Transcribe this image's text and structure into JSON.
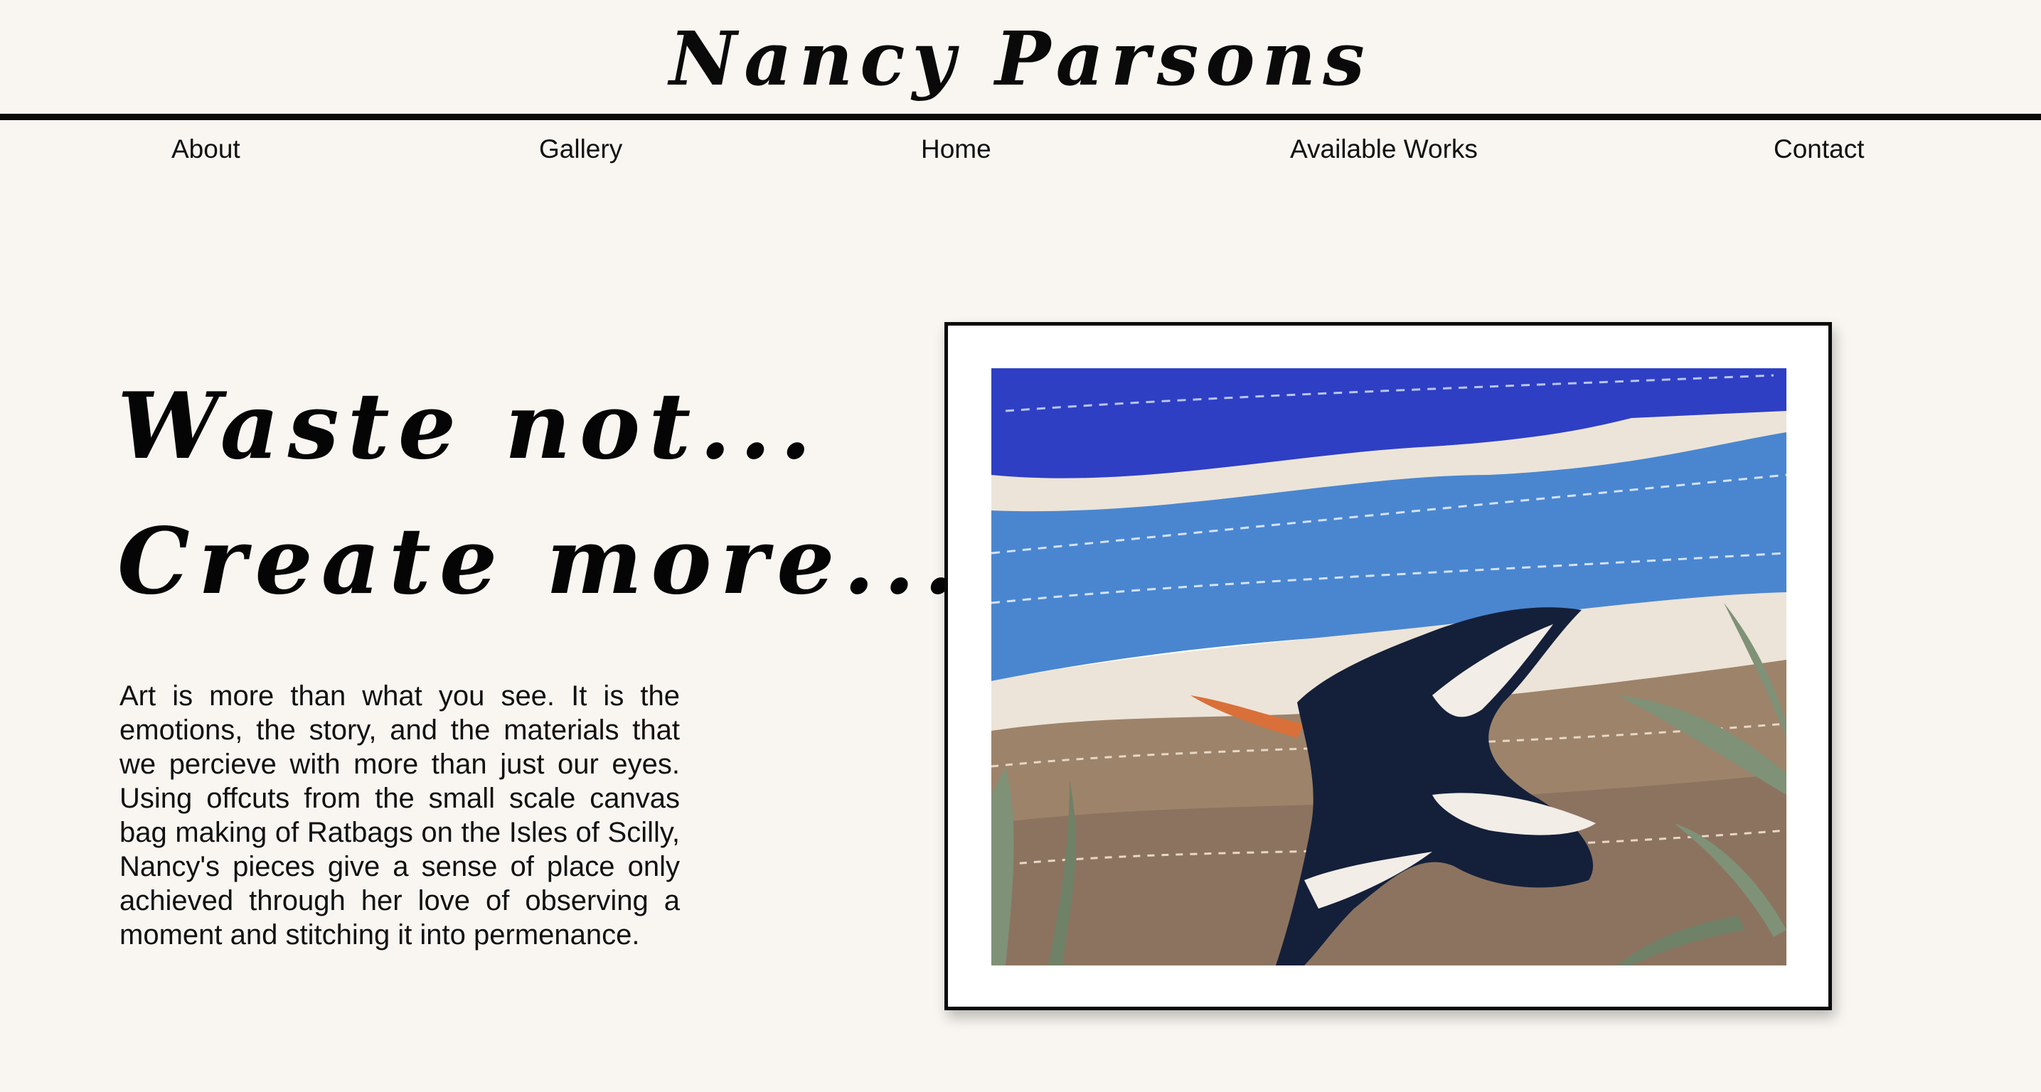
{
  "header": {
    "title": "Nancy Parsons"
  },
  "nav": {
    "items": [
      {
        "label": "About"
      },
      {
        "label": "Gallery"
      },
      {
        "label": "Home"
      },
      {
        "label": "Available Works"
      },
      {
        "label": "Contact"
      }
    ]
  },
  "hero": {
    "headline_line1": "Waste not...",
    "headline_line2": "Create more...",
    "body": "Art is more than what you see. It is the emotions, the story, and the materials that we percieve with more than just our eyes. Using offcuts from the small scale canvas bag making of Ratbags on the Isles of Scilly, Nancy's pieces give a sense of place only achieved through her love of observing a moment and stitching it into permenance."
  },
  "artwork": {
    "icon": "textile-artwork-oystercatcher-image",
    "colors": {
      "sky": "#2e3fc4",
      "sea": "#4a86d0",
      "sand": "#ece4d8",
      "mud": "#9d836a",
      "bird_dark": "#14203a",
      "bird_light": "#f2ede6",
      "beak": "#d9703a",
      "reeds": "#7f9177"
    }
  }
}
